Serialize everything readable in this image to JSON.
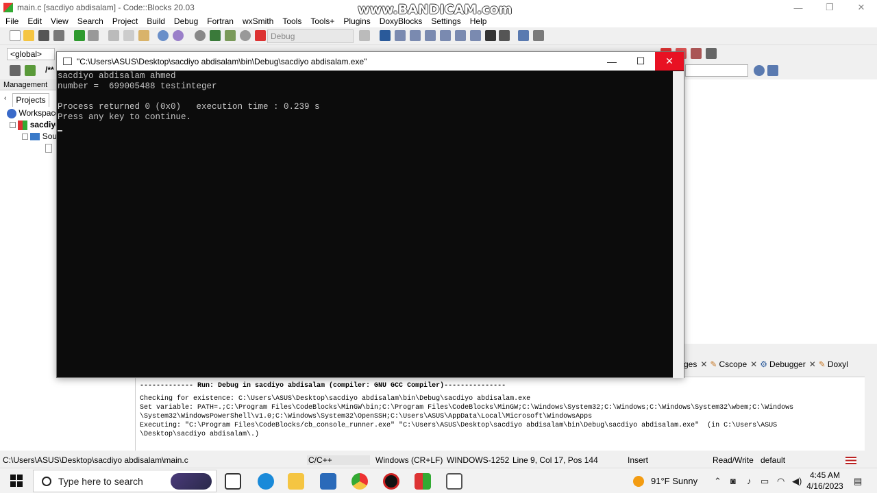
{
  "ide": {
    "window_title": "main.c [sacdiyo abdisalam] - Code::Blocks 20.03",
    "watermark": "www.BANDICAM.com",
    "menu": [
      "File",
      "Edit",
      "View",
      "Search",
      "Project",
      "Build",
      "Debug",
      "Fortran",
      "wxSmith",
      "Tools",
      "Tools+",
      "Plugins",
      "DoxyBlocks",
      "Settings",
      "Help"
    ],
    "build_target": "Debug",
    "scope_combo": "<global>",
    "comment_marker": "/**",
    "management_title": "Management",
    "tab_projects": "Projects",
    "tree": {
      "workspace": "Workspace",
      "project": "sacdiyo",
      "sources": "Sou"
    },
    "log_tabs": {
      "partial": "ges",
      "cscope": "Cscope",
      "debugger": "Debugger",
      "doxy": "Doxyl"
    },
    "build_log": {
      "header": "------------- Run: Debug in sacdiyo abdisalam (compiler: GNU GCC Compiler)---------------",
      "lines": [
        "Checking for existence: C:\\Users\\ASUS\\Desktop\\sacdiyo abdisalam\\bin\\Debug\\sacdiyo abdisalam.exe",
        "Set variable: PATH=.;C:\\Program Files\\CodeBlocks\\MinGW\\bin;C:\\Program Files\\CodeBlocks\\MinGW;C:\\Windows\\System32;C:\\Windows;C:\\Windows\\System32\\wbem;C:\\Windows",
        "\\System32\\WindowsPowerShell\\v1.0;C:\\Windows\\System32\\OpenSSH;C:\\Users\\ASUS\\AppData\\Local\\Microsoft\\WindowsApps",
        "Executing: \"C:\\Program Files\\CodeBlocks/cb_console_runner.exe\" \"C:\\Users\\ASUS\\Desktop\\sacdiyo abdisalam\\bin\\Debug\\sacdiyo abdisalam.exe\"  (in C:\\Users\\ASUS",
        "\\Desktop\\sacdiyo abdisalam\\.)"
      ]
    },
    "status": {
      "file_path": "C:\\Users\\ASUS\\Desktop\\sacdiyo abdisalam\\main.c",
      "language": "C/C++",
      "line_endings": "Windows (CR+LF)",
      "encoding": "WINDOWS-1252",
      "position": "Line 9, Col 17, Pos 144",
      "mode": "Insert",
      "access": "Read/Write",
      "profile": "default"
    }
  },
  "console": {
    "title": "\"C:\\Users\\ASUS\\Desktop\\sacdiyo abdisalam\\bin\\Debug\\sacdiyo abdisalam.exe\"",
    "lines": [
      "sacdiyo abdisalam ahmed",
      "number =  699005488 testinteger",
      "",
      "Process returned 0 (0x0)   execution time : 0.239 s",
      "Press any key to continue."
    ]
  },
  "taskbar": {
    "search_placeholder": "Type here to search",
    "weather": "91°F  Sunny",
    "time": "4:45 AM",
    "date": "4/16/2023"
  },
  "colors": {
    "close_red": "#e81123",
    "console_bg": "#0c0c0c",
    "console_fg": "#c8c8c8"
  }
}
